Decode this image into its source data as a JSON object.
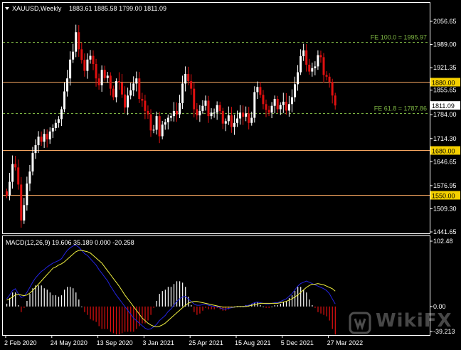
{
  "header": {
    "symbol_label": "XAUUSD,Weekly",
    "ohlc_label": "1883.61 1885.58 1799.00 1811.09"
  },
  "indicator": {
    "label": "MACD(12,26,9) 19.606 35.189 0.000 -20.258",
    "scale_top": "102.48",
    "scale_zero": "0.00",
    "scale_bottom": "-39.213"
  },
  "price_axis": {
    "ticks": [
      "2056.65",
      "1989.00",
      "1921.35",
      "1855.65",
      "1784.00",
      "1714.30",
      "1646.65",
      "1576.95",
      "1509.30",
      "1441.65"
    ],
    "tick_values": [
      2056.65,
      1989.0,
      1921.35,
      1855.65,
      1784.0,
      1714.3,
      1646.65,
      1576.95,
      1509.3,
      1441.65
    ],
    "current_price_label": "1811.09",
    "current_price": 1811.09
  },
  "levels": [
    {
      "label": "1880.00",
      "value": 1880.0,
      "kind": "horizontal",
      "color": "#f4a460"
    },
    {
      "label": "1680.00",
      "value": 1680.0,
      "kind": "horizontal",
      "color": "#f4a460"
    },
    {
      "label": "1550.00",
      "value": 1550.0,
      "kind": "horizontal",
      "color": "#f4a460"
    }
  ],
  "fibo_lines": [
    {
      "label": "FE 100.0 = 1995.97",
      "value": 1995.97,
      "color": "#7cb342"
    },
    {
      "label": "FE 61.8 = 1787.86",
      "value": 1787.86,
      "color": "#7cb342"
    }
  ],
  "time_axis": {
    "labels": [
      "2 Feb 2020",
      "24 May 2020",
      "13 Sep 2020",
      "3 Jan 2021",
      "25 Apr 2021",
      "15 Aug 2021",
      "5 Dec 2021",
      "27 Mar 2022"
    ],
    "label_bar_index": [
      0,
      16,
      32,
      48,
      64,
      80,
      96,
      112
    ]
  },
  "colors": {
    "background": "#000000",
    "bull": "#ffffff",
    "bear": "#e01010",
    "macd_line": "#2323e0",
    "signal_line": "#f0f040",
    "hist_pos": "#ffffff",
    "hist_neg": "#e01010",
    "grid_border": "#ffffff",
    "fibo": "#7cb342",
    "level": "#f4a460",
    "level_label_bg": "#f5d000"
  },
  "watermark": {
    "text": "WikiFX"
  },
  "chart_data": {
    "type": "candlestick",
    "price_range": [
      1441.65,
      2090
    ],
    "macd_range": [
      -39.213,
      102.48
    ],
    "closes": [
      1548,
      1588,
      1640,
      1630,
      1580,
      1475,
      1520,
      1583,
      1618,
      1672,
      1695,
      1720,
      1705,
      1728,
      1712,
      1735,
      1745,
      1760,
      1771,
      1800,
      1852,
      1890,
      1945,
      1968,
      2025,
      1975,
      1944,
      1912,
      1945,
      1956,
      1932,
      1890,
      1870,
      1915,
      1891,
      1898,
      1860,
      1835,
      1882,
      1878,
      1843,
      1805,
      1840,
      1855,
      1875,
      1890,
      1830,
      1825,
      1795,
      1785,
      1738,
      1740,
      1780,
      1721,
      1755,
      1762,
      1775,
      1780,
      1795,
      1785,
      1818,
      1875,
      1903,
      1882,
      1860,
      1800,
      1782,
      1795,
      1810,
      1825,
      1780,
      1790,
      1790,
      1812,
      1795,
      1758,
      1765,
      1782,
      1748,
      1760,
      1773,
      1790,
      1778,
      1788,
      1760,
      1775,
      1850,
      1865,
      1842,
      1815,
      1798,
      1790,
      1810,
      1830,
      1800,
      1812,
      1822,
      1796,
      1815,
      1835,
      1873,
      1908,
      1955,
      1972,
      1930,
      1910,
      1920,
      1925,
      1958,
      1952,
      1900,
      1895,
      1880,
      1840,
      1811
    ],
    "macd": [
      12,
      18,
      25,
      28,
      20,
      14,
      16,
      22,
      30,
      38,
      45,
      50,
      55,
      58,
      62,
      65,
      68,
      70,
      72,
      75,
      82,
      88,
      92,
      95,
      96,
      93,
      88,
      83,
      80,
      75,
      70,
      65,
      58,
      52,
      46,
      40,
      32,
      25,
      18,
      12,
      6,
      0,
      -6,
      -12,
      -18,
      -22,
      -26,
      -30,
      -34,
      -36,
      -35,
      -32,
      -28,
      -22,
      -18,
      -14,
      -8,
      -4,
      2,
      8,
      12,
      15,
      16,
      12,
      8,
      4,
      2,
      2,
      3,
      4,
      2,
      1,
      0,
      0,
      -2,
      -4,
      -4,
      -3,
      -2,
      -1,
      0,
      0,
      0,
      1,
      2,
      4,
      6,
      7,
      6,
      5,
      4,
      4,
      5,
      6,
      6,
      8,
      10,
      12,
      16,
      20,
      26,
      32,
      36,
      38,
      40,
      38,
      36,
      34,
      32,
      30,
      28,
      25,
      20,
      12,
      4
    ],
    "signal": [
      10,
      12,
      15,
      18,
      19,
      18,
      17,
      18,
      21,
      25,
      30,
      35,
      40,
      45,
      50,
      55,
      60,
      62,
      65,
      67,
      70,
      74,
      78,
      82,
      86,
      88,
      88,
      87,
      86,
      84,
      80,
      76,
      72,
      68,
      62,
      56,
      50,
      44,
      38,
      32,
      25,
      18,
      12,
      6,
      0,
      -6,
      -12,
      -18,
      -22,
      -26,
      -29,
      -31,
      -32,
      -31,
      -29,
      -26,
      -22,
      -18,
      -14,
      -10,
      -6,
      -2,
      2,
      5,
      7,
      8,
      8,
      7,
      6,
      5,
      4,
      3,
      2,
      1,
      0,
      -1,
      -1,
      -1,
      -1,
      -1,
      0,
      0,
      0,
      0,
      1,
      2,
      3,
      4,
      5,
      5,
      5,
      5,
      5,
      5,
      5,
      6,
      7,
      8,
      10,
      12,
      15,
      18,
      22,
      26,
      30,
      33,
      35,
      35,
      36,
      35,
      34,
      32,
      30,
      28,
      24
    ]
  }
}
